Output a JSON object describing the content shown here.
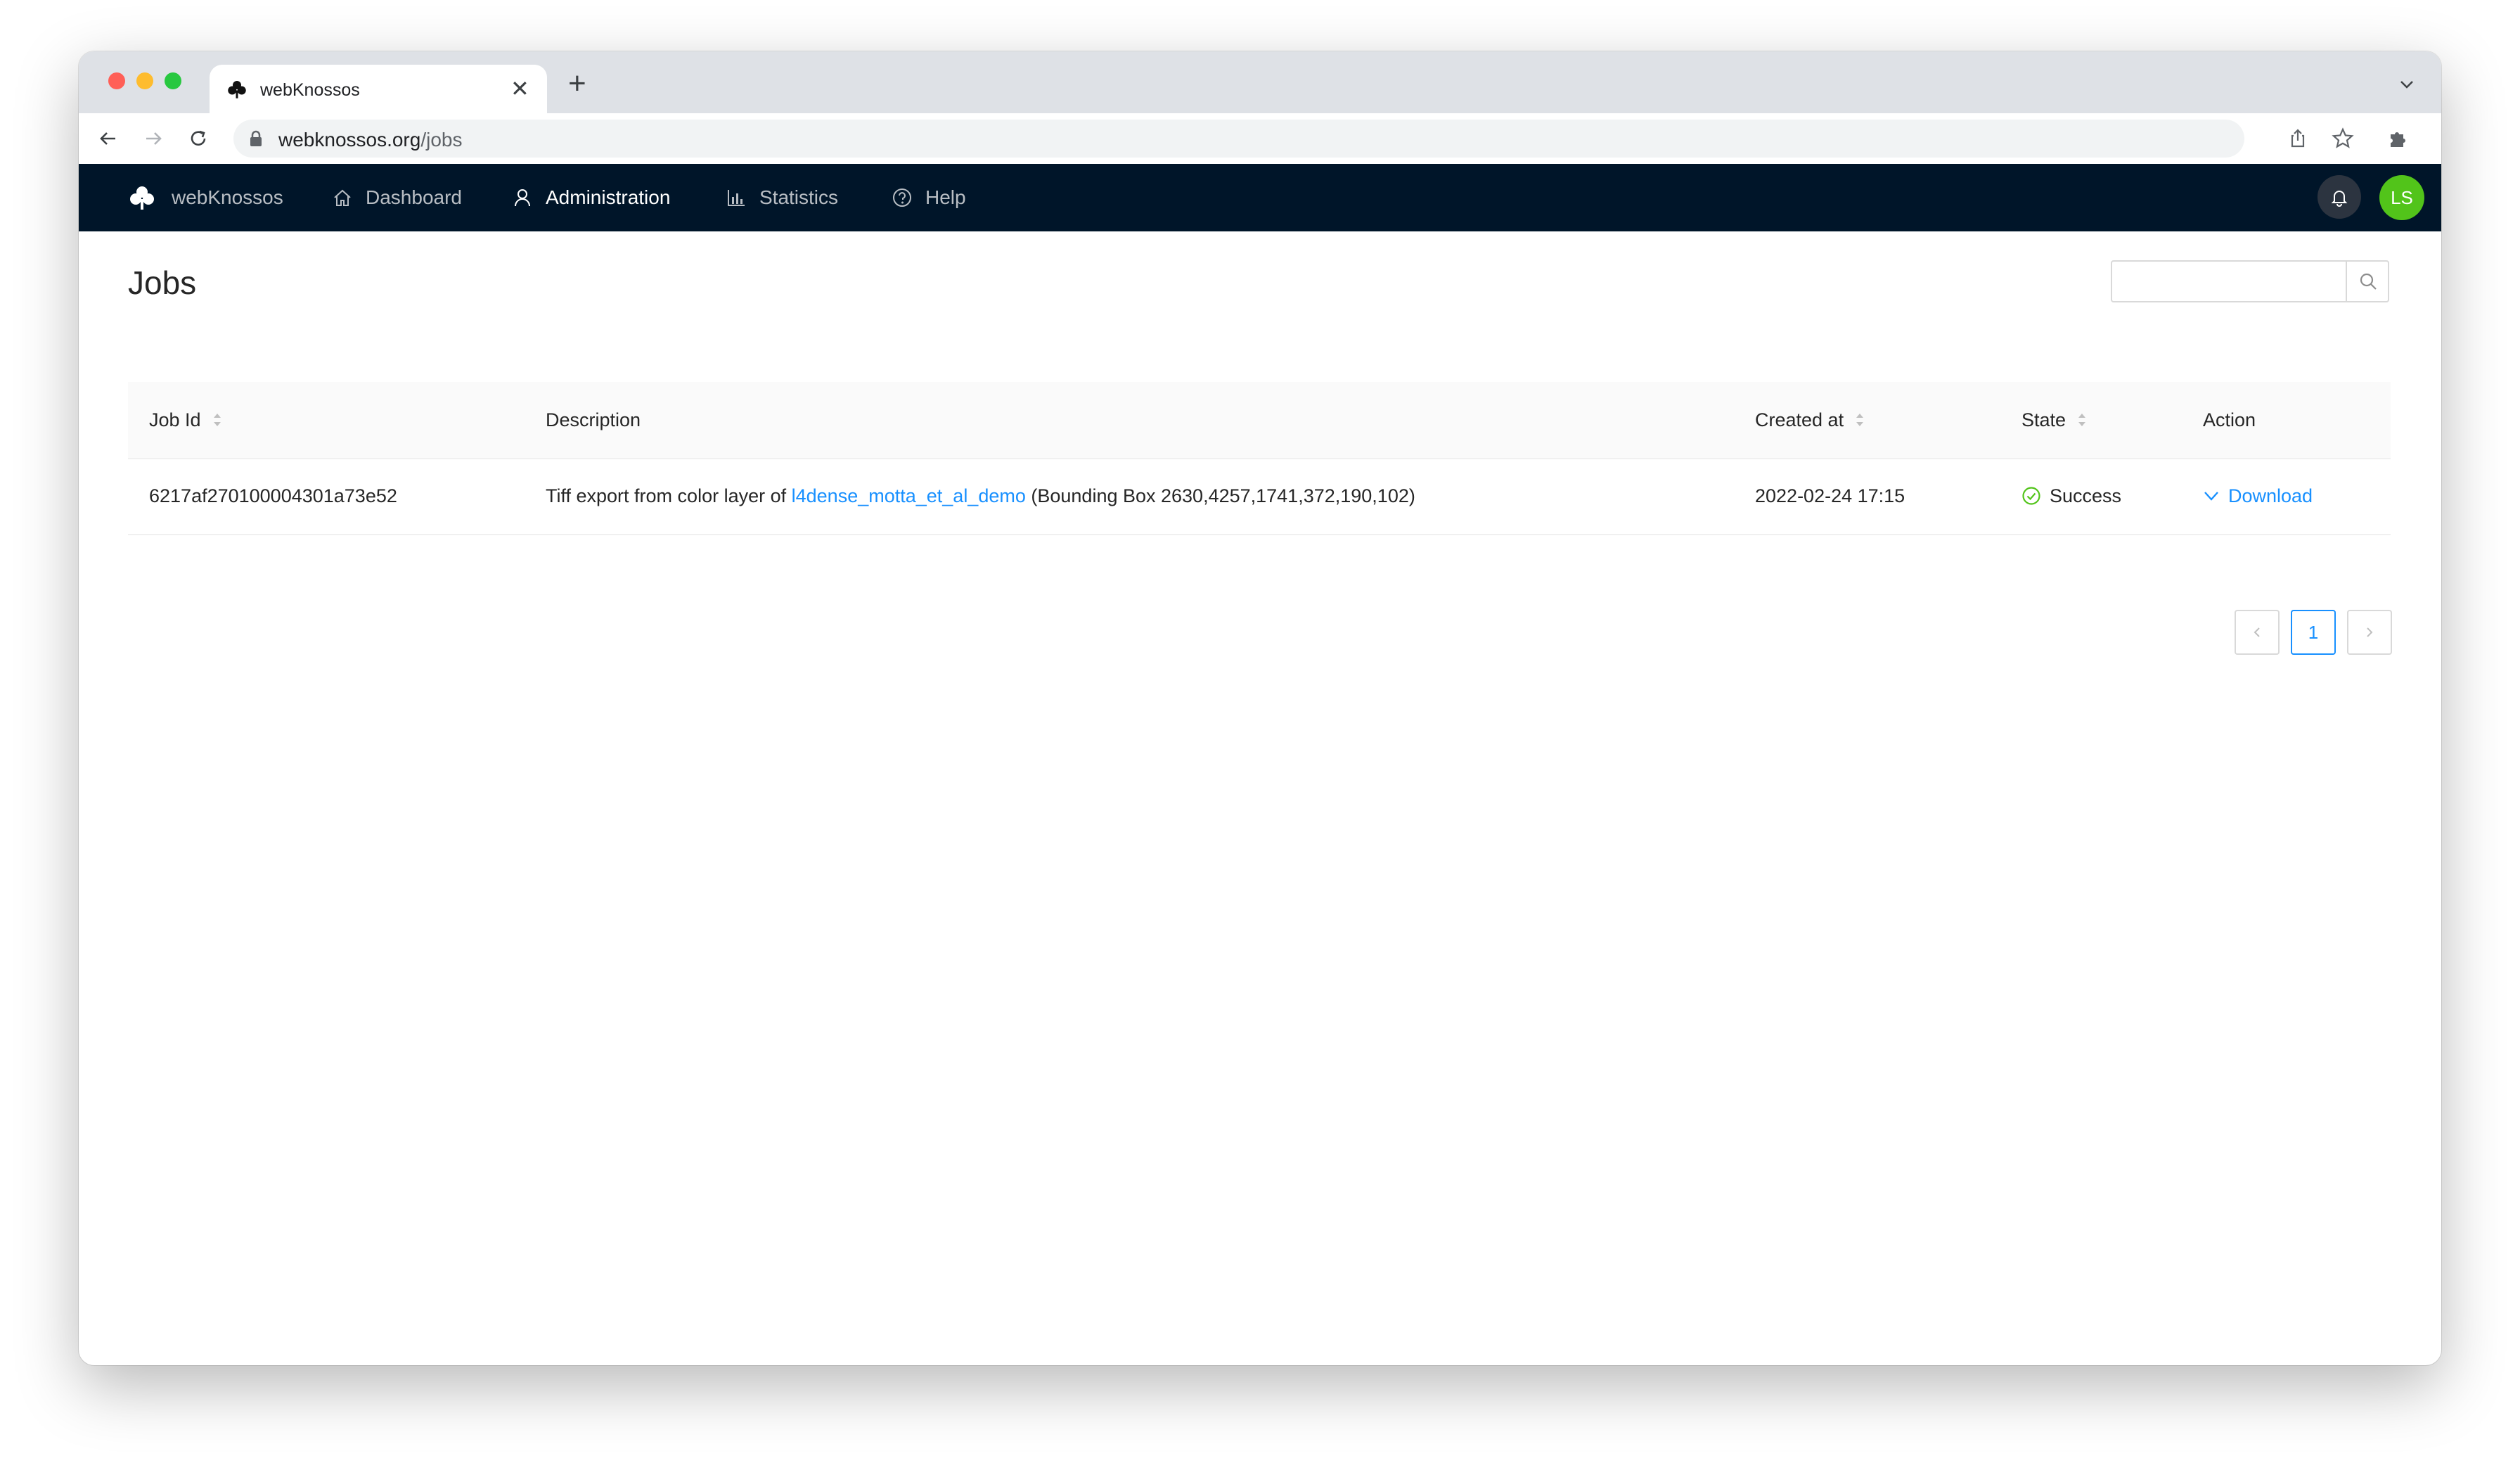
{
  "browser": {
    "tab_title": "webKnossos",
    "url_host": "webknossos.org",
    "url_path": "/jobs"
  },
  "nav": {
    "brand": "webKnossos",
    "items": [
      {
        "label": "Dashboard",
        "icon": "home-icon"
      },
      {
        "label": "Administration",
        "icon": "user-admin-icon"
      },
      {
        "label": "Statistics",
        "icon": "bar-chart-icon"
      },
      {
        "label": "Help",
        "icon": "question-circle-icon"
      }
    ],
    "active": "Administration",
    "avatar_initials": "LS"
  },
  "page": {
    "title": "Jobs",
    "search_placeholder": ""
  },
  "table": {
    "columns": [
      "Job Id",
      "Description",
      "Created at",
      "State",
      "Action"
    ],
    "rows": [
      {
        "job_id": "6217af270100004301a73e52",
        "description_prefix": "Tiff export from color layer of ",
        "description_link": "l4dense_motta_et_al_demo",
        "description_suffix": " (Bounding Box 2630,4257,1741,372,190,102)",
        "created_at": "2022-02-24 17:15",
        "state": "Success",
        "action": "Download"
      }
    ]
  },
  "pagination": {
    "current_page": "1"
  },
  "colors": {
    "nav_bg": "#001529",
    "link": "#1890ff",
    "success": "#52c41a",
    "avatar": "#52c41a"
  }
}
